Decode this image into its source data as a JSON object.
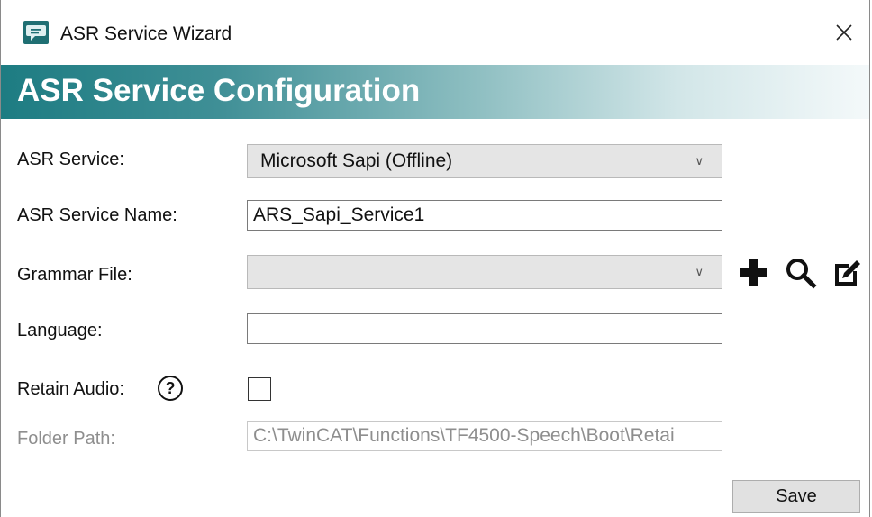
{
  "window": {
    "title": "ASR Service Wizard",
    "icon": "speech-bubble-icon",
    "close_icon": "close-icon"
  },
  "banner": {
    "title": "ASR Service Configuration",
    "gradient_start": "#1d7c82",
    "gradient_end": "#f4f9fa"
  },
  "form": {
    "asr_service": {
      "label": "ASR Service:",
      "value": "Microsoft Sapi (Offline)"
    },
    "asr_service_name": {
      "label": "ASR Service Name:",
      "value": "ARS_Sapi_Service1"
    },
    "grammar_file": {
      "label": "Grammar File:",
      "value": "",
      "buttons": [
        "add-icon",
        "search-icon",
        "edit-icon"
      ]
    },
    "language": {
      "label": "Language:",
      "value": ""
    },
    "retain_audio": {
      "label": "Retain Audio:",
      "help_icon": "question-mark-icon",
      "checked": false
    },
    "folder_path": {
      "label": "Folder Path:",
      "value": "C:\\TwinCAT\\Functions\\TF4500-Speech\\Boot\\Retai"
    }
  },
  "footer": {
    "save_label": "Save"
  }
}
